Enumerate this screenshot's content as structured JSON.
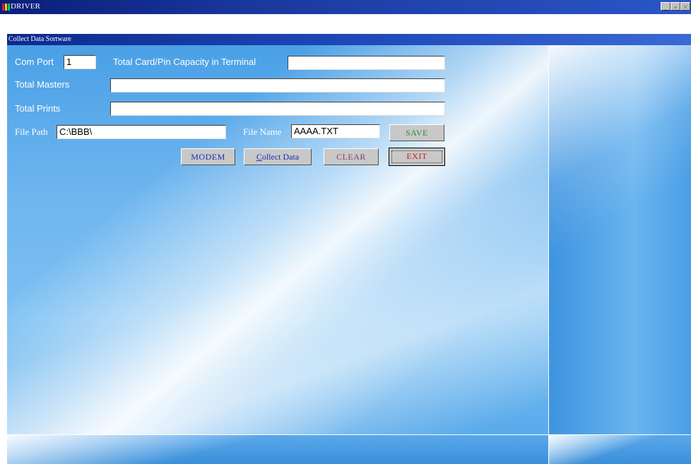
{
  "window": {
    "title": "DRIVER"
  },
  "child_window": {
    "title": "Collect Data Sortware"
  },
  "form": {
    "com_port_label": "Com Port",
    "com_port_value": "1",
    "capacity_label": "Total Card/Pin Capacity in Terminal",
    "capacity_value": "",
    "total_masters_label": "Total Masters",
    "total_masters_value": "",
    "total_prints_label": "Total Prints",
    "total_prints_value": "",
    "file_path_label": "File Path",
    "file_path_value": "C:\\BBB\\",
    "file_name_label": "File Name",
    "file_name_value": "AAAA.TXT"
  },
  "buttons": {
    "save": "SAVE",
    "modem": "MODEM",
    "collect": "Collect Data",
    "clear": "CLEAR",
    "exit": "EXIT"
  },
  "colors": {
    "save_text": "#2e8a3c",
    "modem_text": "#1a2fb0",
    "collect_text": "#1a2fb0",
    "clear_text": "#8a3c6a",
    "exit_text": "#d01818"
  },
  "icons": {
    "app": "driver-app-icon",
    "minimize": "minimize-icon",
    "restore": "restore-icon",
    "close": "close-icon"
  }
}
